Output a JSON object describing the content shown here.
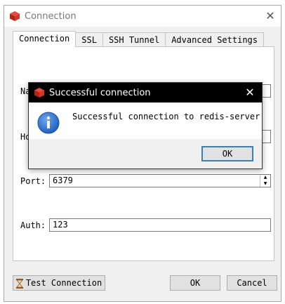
{
  "window": {
    "title": "Connection"
  },
  "tabs": [
    {
      "label": "Connection",
      "active": true
    },
    {
      "label": "SSL",
      "active": false
    },
    {
      "label": "SSH Tunnel",
      "active": false
    },
    {
      "label": "Advanced Settings",
      "active": false
    }
  ],
  "form": {
    "name_label": "Na",
    "host_label": "Ho",
    "port_label": "Port:",
    "port_value": "6379",
    "auth_label": "Auth:",
    "auth_value": "123"
  },
  "buttons": {
    "test_connection": "Test Connection",
    "ok": "OK",
    "cancel": "Cancel"
  },
  "dialog": {
    "title": "Successful connection",
    "message": "Successful connection to redis-server",
    "ok": "OK"
  },
  "colors": {
    "dialog_titlebar": "#000000",
    "window_bg": "#f0f0f0",
    "info_blue": "#1f5fbf",
    "focus_border": "#3c7fb1"
  },
  "icons": {
    "app": "redis-cube-icon",
    "info": "info-icon",
    "test": "hourglass-icon",
    "close": "close-icon"
  }
}
